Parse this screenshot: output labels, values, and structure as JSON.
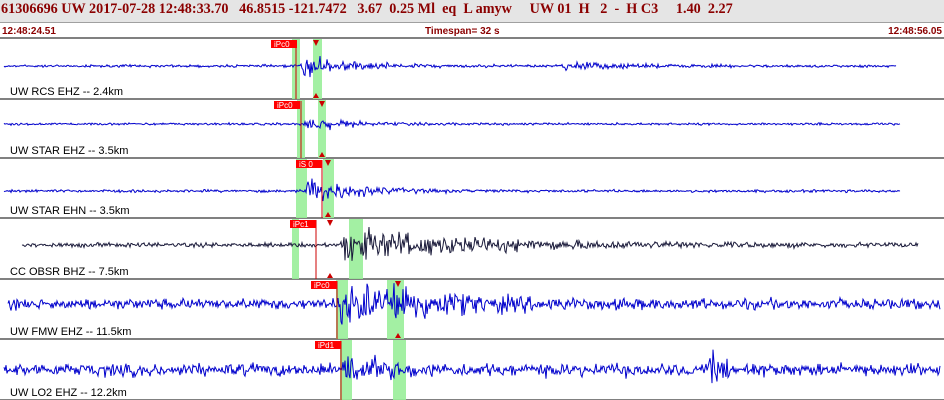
{
  "header": {
    "event_line": "61306696 UW 2017-07-28 12:48:33.70   46.8515 -121.7472   3.67  0.25 Ml  eq  L amyw     UW 01  H   2  -  H C3     1.40  2.27",
    "start_time": "12:48:24.51",
    "timespan": "Timespan=  32 s",
    "end_time": "12:48:56.05"
  },
  "colors": {
    "trace": "#0000cc",
    "trace_alt": "#1a1a3a",
    "pick_box": "#ff0000",
    "pick_window": "#99ee99",
    "pick_line": "#cc0000",
    "header_text": "#8b0000"
  },
  "channels": [
    {
      "label": "UW RCS EHZ -- 2.4km",
      "pick": "iPc0",
      "trace_color": "blue"
    },
    {
      "label": "UW STAR EHZ -- 3.5km",
      "pick": "iPc0",
      "trace_color": "blue"
    },
    {
      "label": "UW STAR EHN -- 3.5km",
      "pick": "iS 0",
      "trace_color": "blue"
    },
    {
      "label": "CC OBSR BHZ -- 7.5km",
      "pick": "iPc1",
      "trace_color": "dark"
    },
    {
      "label": "UW FMW EHZ -- 11.5km",
      "pick": "iPc0",
      "trace_color": "blue"
    },
    {
      "label": "UW LO2 EHZ -- 12.2km",
      "pick": "iPd1",
      "trace_color": "blue"
    }
  ]
}
